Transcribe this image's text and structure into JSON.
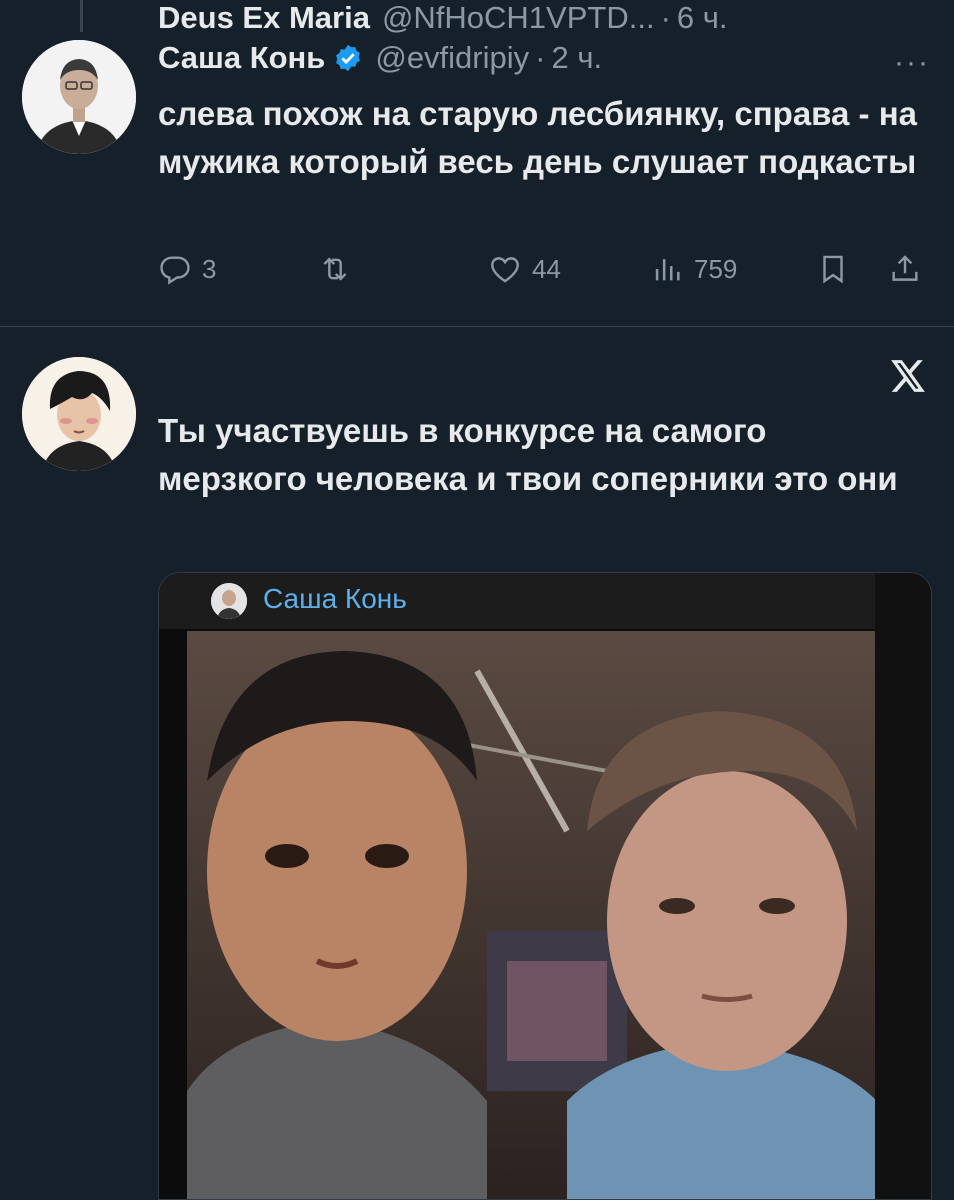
{
  "tweets": [
    {
      "name": "Саша Конь",
      "verified": true,
      "handle": "@evfidripiy",
      "dot": "·",
      "time": "2 ч.",
      "more": "···",
      "text": "слева похож на старую лесбиянку, справа - на мужика который весь день слушает подкасты",
      "actions": {
        "replies": "3",
        "reposts": "",
        "likes": "44",
        "views": "759"
      }
    },
    {
      "name": "Deus Ex Maria",
      "handle": "@NfHoCH1VPTD...",
      "dot": "·",
      "time": "6 ч.",
      "text": "Ты участвуешь в конкурсе на самого мерзкого человека и твои соперники это они",
      "media": {
        "chat_name": "Саша Конь"
      }
    }
  ],
  "colors": {
    "background": "#15202b",
    "text": "#e7e9ea",
    "muted": "#8b98a5",
    "verified": "#1d9bf0",
    "telegram_name": "#5fb0ea"
  },
  "icons": [
    "verified-badge-icon",
    "more-icon",
    "reply-icon",
    "repost-icon",
    "like-icon",
    "views-icon",
    "bookmark-icon",
    "share-icon",
    "x-logo-icon"
  ]
}
